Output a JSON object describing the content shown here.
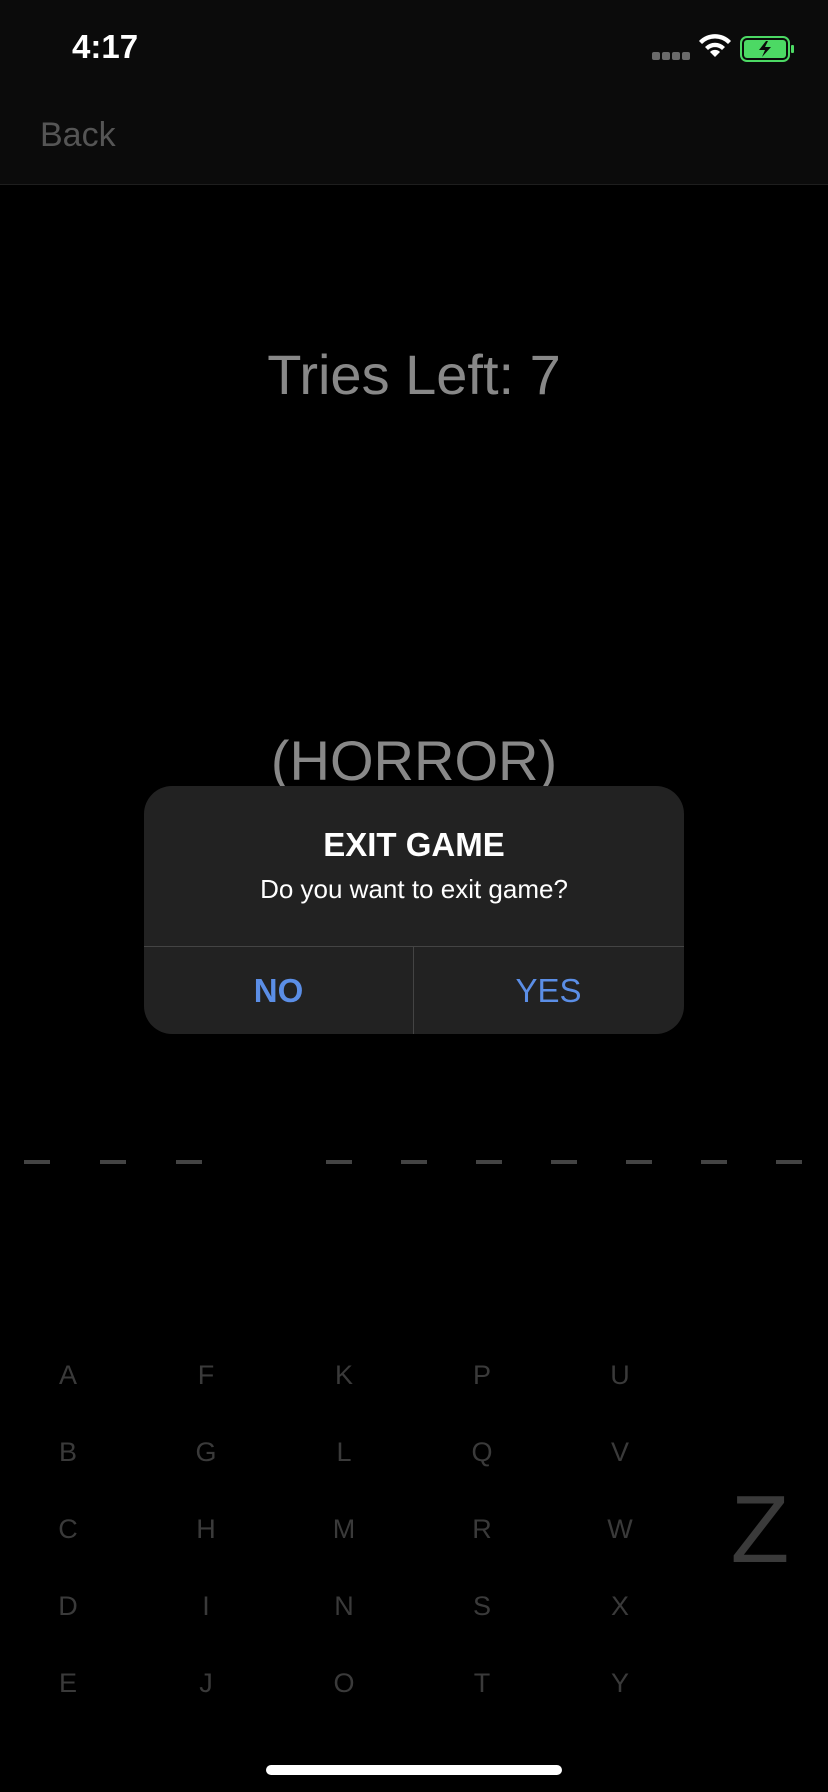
{
  "status_bar": {
    "time": "4:17"
  },
  "nav": {
    "back_label": "Back"
  },
  "game": {
    "tries_label": "Tries Left: 7",
    "category": "(HORROR)",
    "keys": {
      "col1": [
        "A",
        "B",
        "C",
        "D",
        "E"
      ],
      "col2": [
        "F",
        "G",
        "H",
        "I",
        "J"
      ],
      "col3": [
        "K",
        "L",
        "M",
        "N",
        "O"
      ],
      "col4": [
        "P",
        "Q",
        "R",
        "S",
        "T"
      ],
      "col5": [
        "U",
        "V",
        "W",
        "X",
        "Y"
      ],
      "extra": "Z"
    }
  },
  "alert": {
    "title": "EXIT GAME",
    "message": "Do you want to exit game?",
    "no_label": "NO",
    "yes_label": "YES"
  },
  "colors": {
    "background": "#000000",
    "alert_bg": "#222222",
    "accent": "#5b8ee6",
    "battery_fill": "#4cd964"
  }
}
